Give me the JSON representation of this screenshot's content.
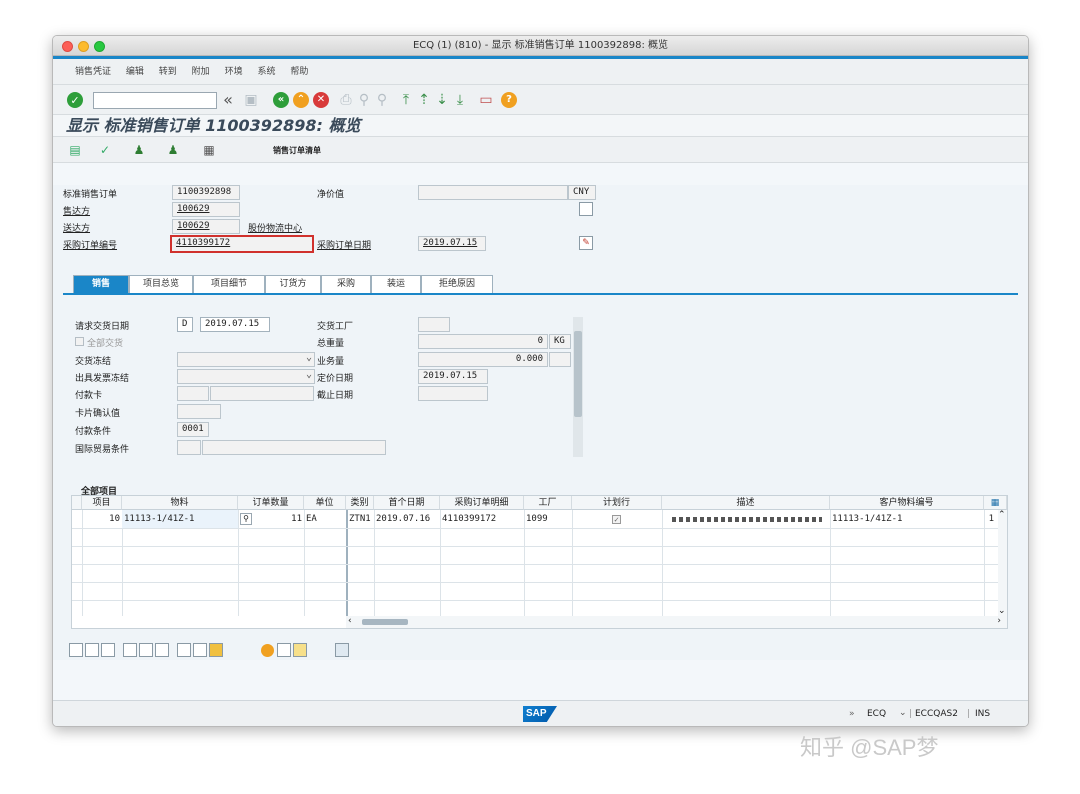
{
  "window": {
    "title": "ECQ (1) (810) - 显示 标准销售订单 1100392898: 概览"
  },
  "menu": [
    "销售凭证",
    "编辑",
    "转到",
    "附加",
    "环境",
    "系统",
    "帮助"
  ],
  "page_title": "显示 标准销售订单 1100392898: 概览",
  "app_toolbar": {
    "order_list_label": "销售订单清单"
  },
  "header": {
    "order_label": "标准销售订单",
    "order_no": "1100392898",
    "net_value_label": "净价值",
    "net_value_currency": "CNY",
    "sold_to_label": "售达方",
    "sold_to_no": "100629",
    "ship_to_label": "送达方",
    "ship_to_no": "100629",
    "ship_to_name": "股份物流中心",
    "po_label": "采购订单编号",
    "po_no": "4110399172",
    "po_date_label": "采购订单日期",
    "po_date": "2019.07.15"
  },
  "tabs": [
    "销售",
    "项目总览",
    "项目细节",
    "订货方",
    "采购",
    "装运",
    "拒绝原因"
  ],
  "sales": {
    "req_date_label": "请求交货日期",
    "req_date_type": "D",
    "req_date": "2019.07.15",
    "complete_label": "全部交货",
    "delivery_block_label": "交货冻结",
    "billing_block_label": "出具发票冻结",
    "card_label": "付款卡",
    "card_verify_label": "卡片确认值",
    "payment_terms_label": "付款条件",
    "payment_terms": "0001",
    "incoterms_label": "国际贸易条件",
    "plant_label": "交货工厂",
    "weight_label": "总重量",
    "weight_value": "0",
    "weight_unit": "KG",
    "volume_label": "业务量",
    "volume_value": "0.000",
    "pricing_date_label": "定价日期",
    "pricing_date": "2019.07.15",
    "cutoff_label": "截止日期"
  },
  "items": {
    "caption": "全部项目",
    "columns": [
      "项目",
      "物料",
      "订单数量",
      "单位",
      "类别",
      "首个日期",
      "采购订单明细",
      "工厂",
      "计划行",
      "描述",
      "客户物料编号"
    ],
    "rows": [
      {
        "item": "10",
        "material": "11113-1/41Z-1",
        "qty": "11",
        "unit": "EA",
        "category": "ZTN1",
        "first_date": "2019.07.16",
        "po_item": "4110399172",
        "plant": "1099",
        "customer_material": "11113-1/41Z-1",
        "extra": "1"
      }
    ]
  },
  "status": {
    "system": "ECQ",
    "server": "ECCQAS2",
    "mode": "INS",
    "arrows": "»"
  },
  "watermark": "知乎 @SAP梦"
}
